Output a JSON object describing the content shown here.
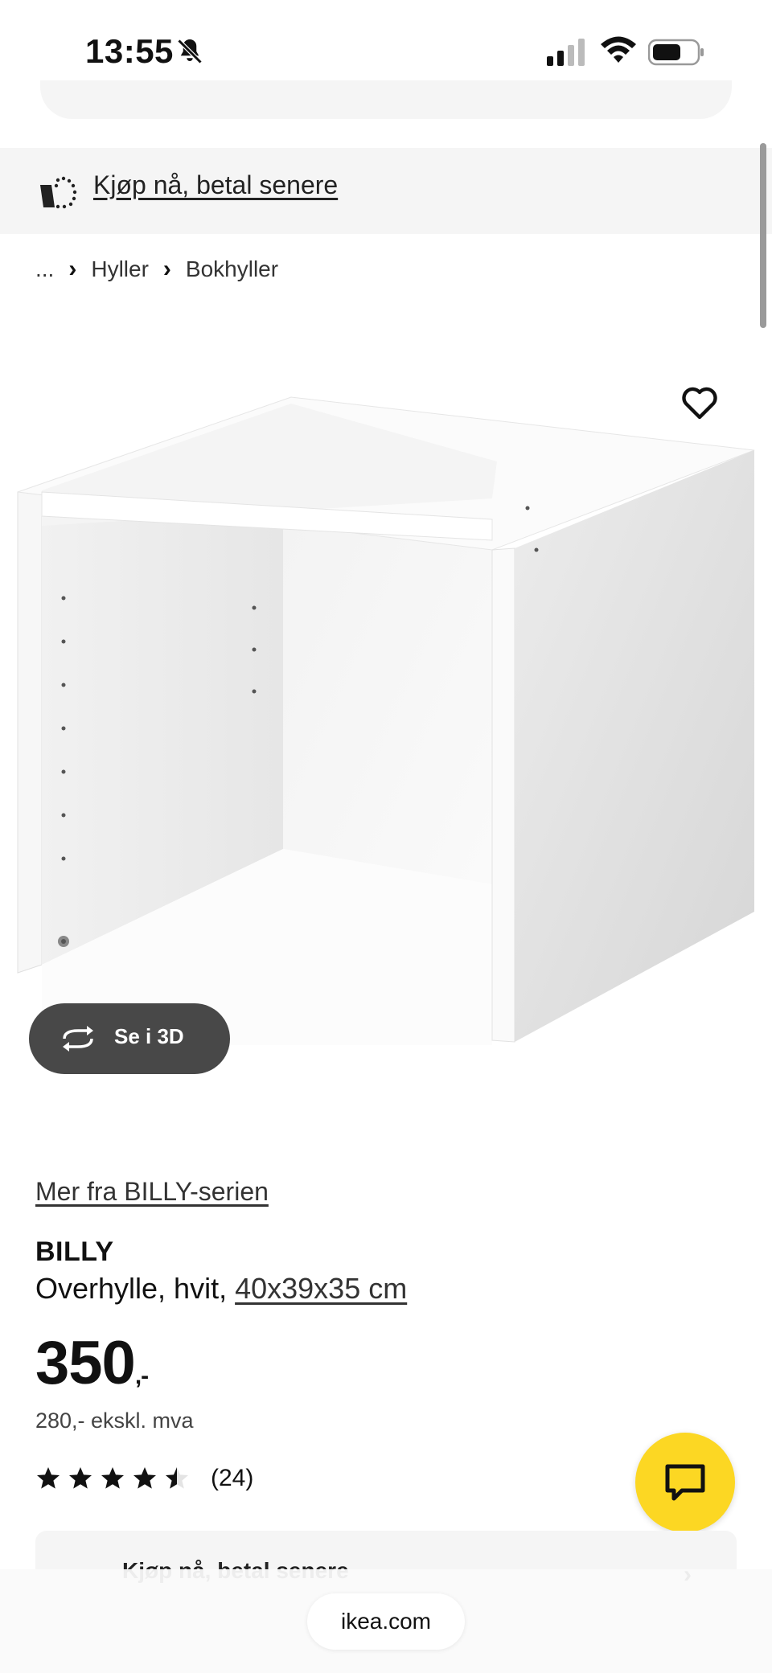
{
  "status_bar": {
    "time": "13:55",
    "icons": [
      "bell-slash-icon",
      "cellular-signal-icon",
      "wifi-icon",
      "battery-icon"
    ]
  },
  "banner": {
    "text": "Kjøp nå, betal senere",
    "icon": "basket-dotted-icon"
  },
  "breadcrumb": {
    "items": [
      "...",
      "Hyller",
      "Bokhyller"
    ]
  },
  "product": {
    "series_link": "Mer fra BILLY-serien",
    "name": "BILLY",
    "description_prefix": "Overhylle, hvit, ",
    "size": "40x39x35 cm",
    "price": "350",
    "price_suffix": ",-",
    "price_ex_vat": "280,- ekskl. mva",
    "rating": 4.5,
    "review_count": "(24)",
    "view3d_label": "Se i 3D"
  },
  "card": {
    "text": "Kjøp nå, betal senere"
  },
  "browser": {
    "url": "ikea.com"
  },
  "colors": {
    "chat_button": "#fcd723",
    "view3d_button": "#484848",
    "banner_bg": "#f5f5f5"
  }
}
